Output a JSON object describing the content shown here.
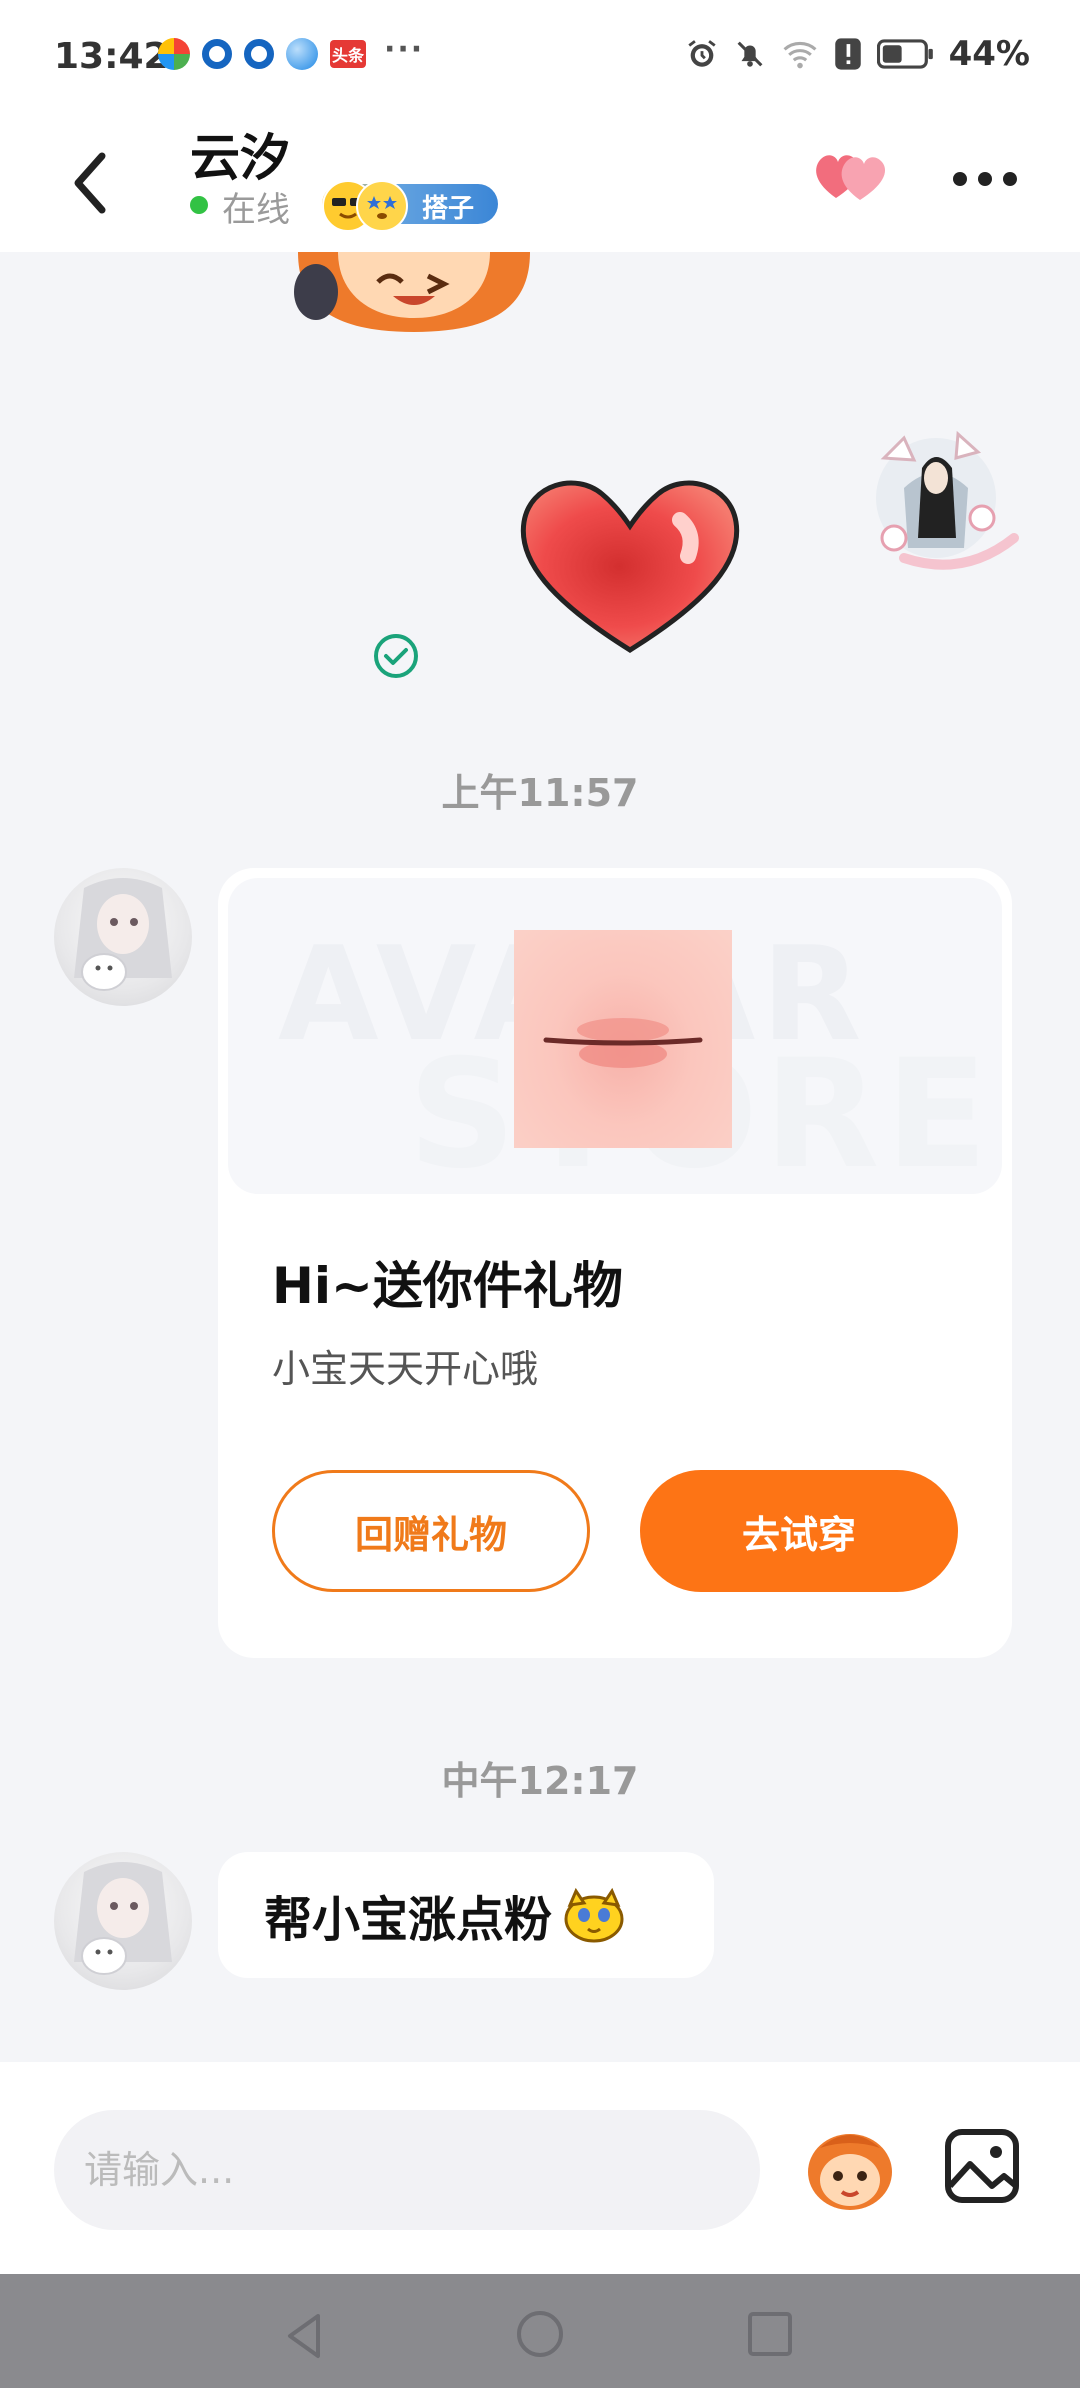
{
  "status_bar": {
    "time": "13:42",
    "left_icons": [
      "app-icon-multicolor",
      "app-icon-blue-circle",
      "app-icon-blue-circle",
      "app-icon-blue-ball",
      "toutiao-icon",
      "more-icon"
    ],
    "news_label": "头条",
    "right_icons": [
      "alarm-icon",
      "mute-icon",
      "wifi-icon",
      "alert-icon",
      "battery-icon"
    ],
    "battery": "44%"
  },
  "header": {
    "name": "云汐",
    "status": "在线",
    "badge_label": "搭子",
    "icons": [
      "back-icon",
      "hearts-icon",
      "more-icon"
    ]
  },
  "messages": {
    "timestamp_1": "上午11:57",
    "gift_card": {
      "title": "Hi~送你件礼物",
      "subtitle": "小宝天天开心哦",
      "return_gift_label": "回赠礼物",
      "try_on_label": "去试穿",
      "watermark_line1": "AVATAR",
      "watermark_line2": "STORE"
    },
    "timestamp_2": "中午12:17",
    "text_message": "帮小宝涨点粉"
  },
  "input": {
    "placeholder": "请输入..."
  },
  "colors": {
    "accent_orange": "#fd7415",
    "online_green": "#32c244",
    "check_green": "#1aa37a",
    "heart_red": "#e53935"
  }
}
